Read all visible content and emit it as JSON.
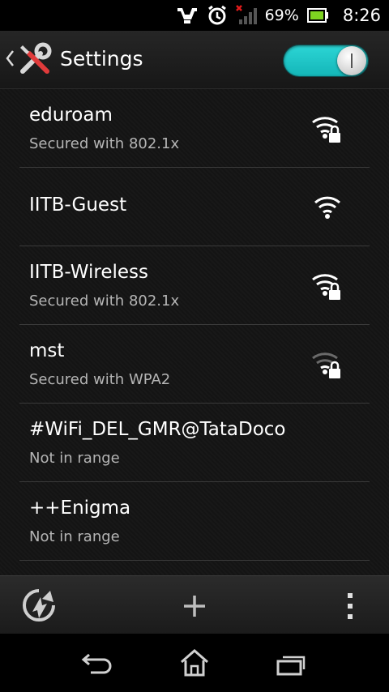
{
  "status": {
    "battery_percent": "69%",
    "time": "8:26"
  },
  "header": {
    "title": "Settings",
    "wifi_enabled": true
  },
  "networks": [
    {
      "name": "eduroam",
      "sub": "Secured with 802.1x",
      "signal": "strong",
      "locked": true
    },
    {
      "name": "IITB-Guest",
      "sub": "",
      "signal": "strong",
      "locked": false
    },
    {
      "name": "IITB-Wireless",
      "sub": "Secured with 802.1x",
      "signal": "strong",
      "locked": true
    },
    {
      "name": "mst",
      "sub": "Secured with WPA2",
      "signal": "weak",
      "locked": true
    },
    {
      "name": "#WiFi_DEL_GMR@TataDocomo",
      "sub": "Not in range",
      "signal": "none",
      "locked": false
    },
    {
      "name": "++Enigma",
      "sub": "Not in range",
      "signal": "none",
      "locked": false
    }
  ],
  "icons": {
    "status": [
      "usb-debug-icon",
      "alarm-clock-icon",
      "signal-no-service-icon",
      "battery-icon"
    ],
    "header": [
      "back-caret-icon",
      "tools-settings-icon"
    ],
    "bottom": [
      "wps-icon",
      "add-icon",
      "overflow-menu-icon"
    ],
    "nav": [
      "back-icon",
      "home-icon",
      "recent-apps-icon"
    ]
  }
}
